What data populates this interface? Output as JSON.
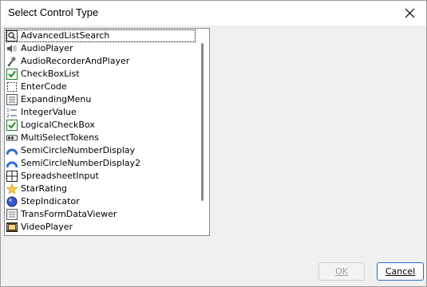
{
  "window": {
    "title": "Select Control Type"
  },
  "list": {
    "items": [
      {
        "label": "AdvancedListSearch",
        "icon": "search-icon"
      },
      {
        "label": "AudioPlayer",
        "icon": "speaker-icon"
      },
      {
        "label": "AudioRecorderAndPlayer",
        "icon": "microphone-icon"
      },
      {
        "label": "CheckBoxList",
        "icon": "checkbox-icon"
      },
      {
        "label": "EnterCode",
        "icon": "dashed-box-icon"
      },
      {
        "label": "ExpandingMenu",
        "icon": "menu-icon"
      },
      {
        "label": "IntegerValue",
        "icon": "numbered-list-icon"
      },
      {
        "label": "LogicalCheckBox",
        "icon": "checkbox-icon"
      },
      {
        "label": "MultiSelectTokens",
        "icon": "tokens-icon"
      },
      {
        "label": "SemiCircleNumberDisplay",
        "icon": "gauge-icon"
      },
      {
        "label": "SemiCircleNumberDisplay2",
        "icon": "gauge-icon"
      },
      {
        "label": "SpreadsheetInput",
        "icon": "grid-icon"
      },
      {
        "label": "StarRating",
        "icon": "star-icon"
      },
      {
        "label": "StepIndicator",
        "icon": "circle-icon"
      },
      {
        "label": "TransFormDataViewer",
        "icon": "data-viewer-icon"
      },
      {
        "label": "VideoPlayer",
        "icon": "film-icon"
      }
    ]
  },
  "buttons": {
    "ok_label": "OK",
    "cancel_label": "Cancel"
  },
  "colors": {
    "dialog_bg": "#f0f0f0",
    "focus_border": "#2c6bd6",
    "checkbox_green": "#1e8c1e"
  }
}
